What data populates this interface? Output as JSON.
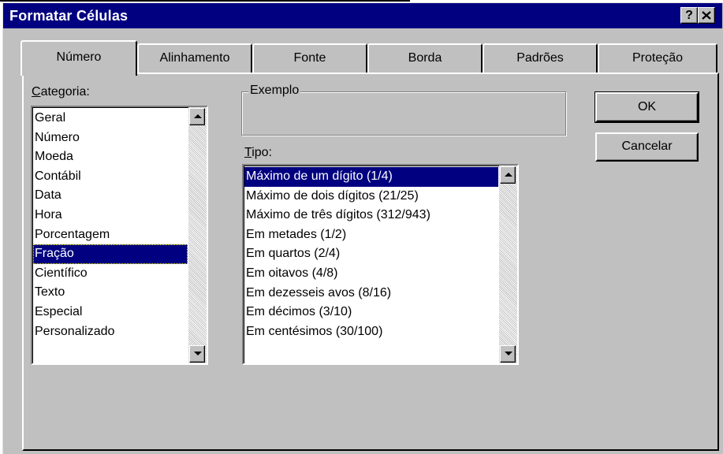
{
  "window": {
    "title": "Formatar Células",
    "help_label": "?",
    "close_label": "✕"
  },
  "tabs": [
    {
      "label": "Número",
      "active": true
    },
    {
      "label": "Alinhamento",
      "active": false
    },
    {
      "label": "Fonte",
      "active": false
    },
    {
      "label": "Borda",
      "active": false
    },
    {
      "label": "Padrões",
      "active": false
    },
    {
      "label": "Proteção",
      "active": false
    }
  ],
  "category": {
    "label_accel": "C",
    "label_rest": "ategoria:",
    "items": [
      "Geral",
      "Número",
      "Moeda",
      "Contábil",
      "Data",
      "Hora",
      "Porcentagem",
      "Fração",
      "Científico",
      "Texto",
      "Especial",
      "Personalizado"
    ],
    "selected": "Fração"
  },
  "example": {
    "label": "Exemplo",
    "value": ""
  },
  "type": {
    "label_accel": "T",
    "label_rest": "ipo:",
    "items": [
      "Máximo de um dígito (1/4)",
      "Máximo de dois dígitos (21/25)",
      "Máximo de três dígitos (312/943)",
      "Em metades (1/2)",
      "Em quartos (2/4)",
      "Em oitavos (4/8)",
      "Em dezesseis avos (8/16)",
      "Em décimos (3/10)",
      "Em centésimos (30/100)"
    ],
    "selected": "Máximo de um dígito (1/4)"
  },
  "buttons": {
    "ok": "OK",
    "cancel": "Cancelar"
  },
  "icons": {
    "scroll_up": "scroll-up-arrow-icon",
    "scroll_down": "scroll-down-arrow-icon"
  },
  "colors": {
    "title_bar": "#000080",
    "face": "#c0c0c0",
    "selection": "#000080"
  }
}
